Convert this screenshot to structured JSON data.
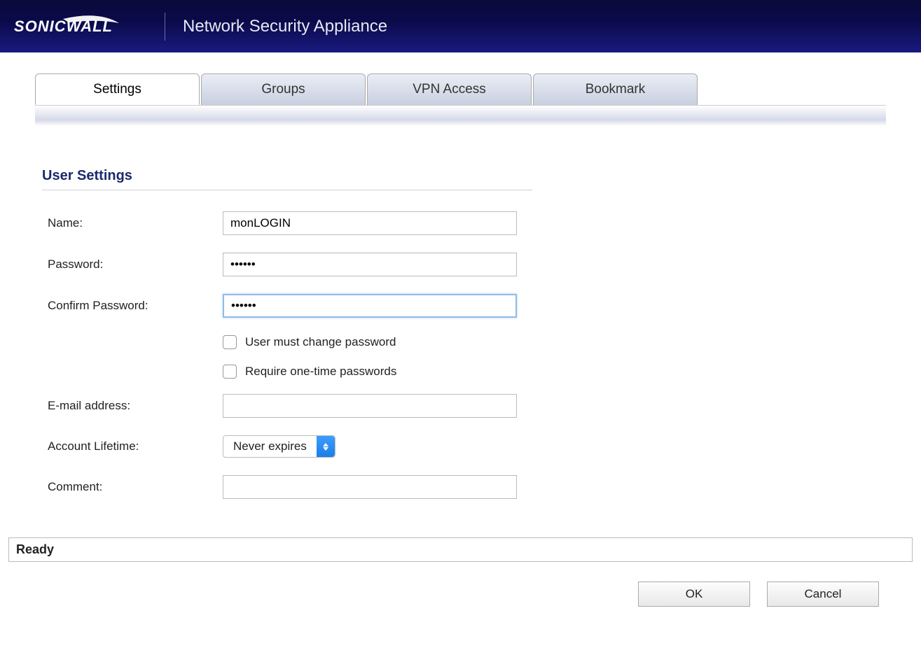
{
  "header": {
    "brand": "SONICWALL",
    "title": "Network Security Appliance"
  },
  "tabs": [
    {
      "label": "Settings",
      "active": true
    },
    {
      "label": "Groups",
      "active": false
    },
    {
      "label": "VPN Access",
      "active": false
    },
    {
      "label": "Bookmark",
      "active": false
    }
  ],
  "section_title": "User Settings",
  "form": {
    "name_label": "Name:",
    "name_value": "monLOGIN",
    "password_label": "Password:",
    "password_value": "••••••",
    "confirm_password_label": "Confirm Password:",
    "confirm_password_value": "••••••",
    "must_change_label": "User must change password",
    "must_change_checked": false,
    "require_otp_label": "Require one-time passwords",
    "require_otp_checked": false,
    "email_label": "E-mail address:",
    "email_value": "",
    "lifetime_label": "Account Lifetime:",
    "lifetime_value": "Never expires",
    "comment_label": "Comment:",
    "comment_value": ""
  },
  "status": "Ready",
  "buttons": {
    "ok": "OK",
    "cancel": "Cancel"
  }
}
